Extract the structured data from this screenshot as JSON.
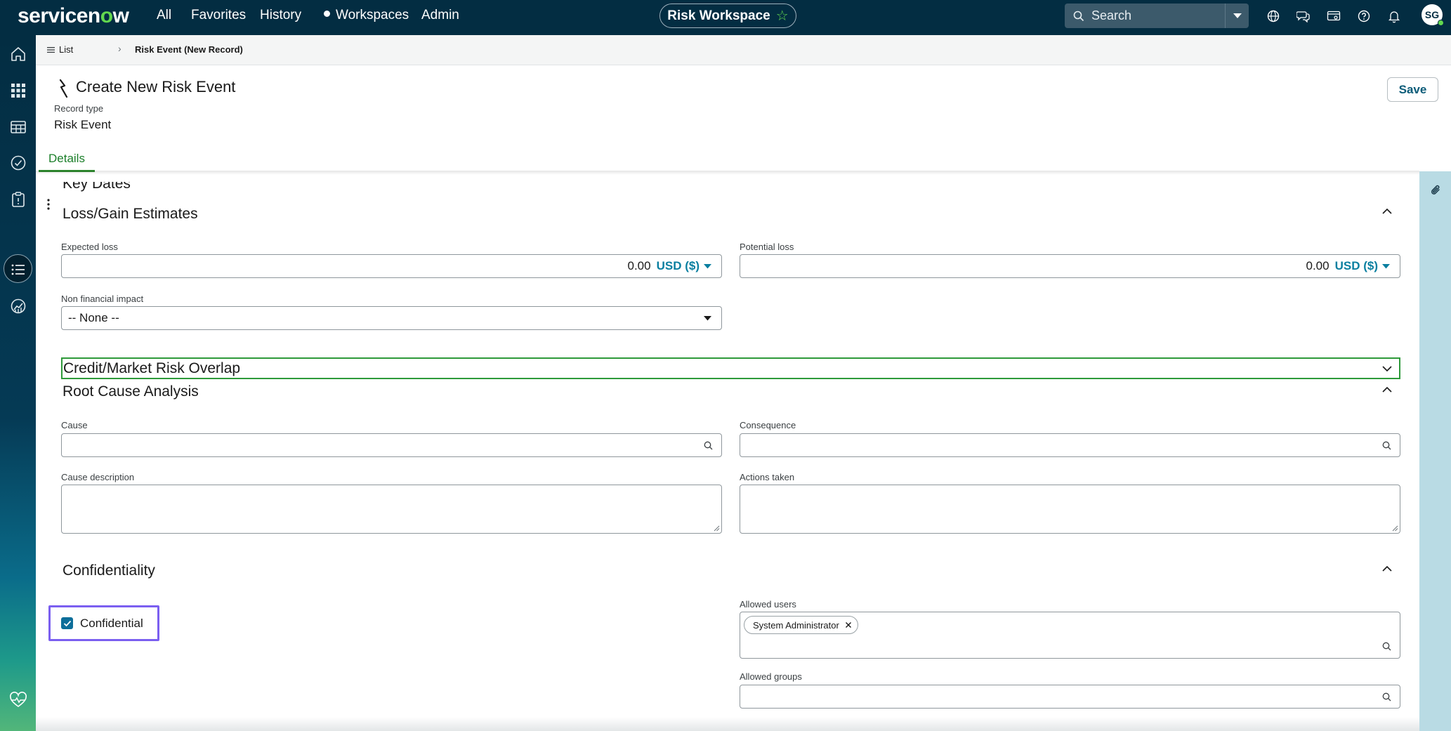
{
  "topnav": {
    "logo_pre": "servicen",
    "logo_o": "o",
    "logo_post": "w",
    "items": [
      "All",
      "Favorites",
      "History",
      "Workspaces",
      "Admin"
    ],
    "workspace": "Risk Workspace",
    "search_placeholder": "Search",
    "avatar_initials": "SG"
  },
  "breadcrumb": {
    "list_label": "List",
    "current": "Risk Event (New Record)"
  },
  "header": {
    "title": "Create New Risk Event",
    "record_type_label": "Record type",
    "record_type_value": "Risk Event",
    "save_label": "Save",
    "tab": "Details"
  },
  "sections": {
    "key_dates": "Key Dates",
    "loss_gain": {
      "title": "Loss/Gain Estimates",
      "expected_loss_label": "Expected loss",
      "expected_loss_value": "0.00",
      "potential_loss_label": "Potential loss",
      "potential_loss_value": "0.00",
      "currency": "USD ($)",
      "non_financial_label": "Non financial impact",
      "non_financial_value": "-- None --"
    },
    "credit_market": {
      "title": "Credit/Market Risk Overlap"
    },
    "root_cause": {
      "title": "Root Cause Analysis",
      "cause_label": "Cause",
      "consequence_label": "Consequence",
      "cause_description_label": "Cause description",
      "actions_taken_label": "Actions taken"
    },
    "confidentiality": {
      "title": "Confidentiality",
      "confidential_label": "Confidential",
      "confidential_checked": true,
      "allowed_users_label": "Allowed users",
      "allowed_users": [
        "System Administrator"
      ],
      "allowed_groups_label": "Allowed groups"
    }
  },
  "colors": {
    "nav_bg": "#032d42",
    "accent_green": "#62d84e",
    "link_blue": "#0a7fa0",
    "focus_green": "#2e9a3a",
    "highlight_purple": "#7b5ff0"
  }
}
